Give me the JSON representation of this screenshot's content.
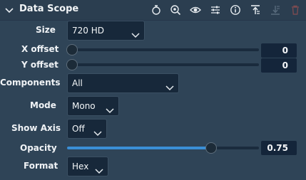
{
  "header": {
    "title": "Data Scope",
    "icons": [
      "stopwatch-icon",
      "zoom-icon",
      "eye-icon",
      "sliders-icon",
      "info-icon",
      "move-up-icon",
      "move-down-icon",
      "trash-icon"
    ]
  },
  "fields": {
    "size": {
      "label": "Size",
      "value": "720 HD"
    },
    "x_offset": {
      "label": "X offset",
      "value": "0",
      "level": 0.0
    },
    "y_offset": {
      "label": "Y offset",
      "value": "0",
      "level": 0.0
    },
    "components": {
      "label": "Components",
      "value": "All"
    },
    "mode": {
      "label": "Mode",
      "value": "Mono"
    },
    "show_axis": {
      "label": "Show Axis",
      "value": "Off"
    },
    "opacity": {
      "label": "Opacity",
      "value": "0.75",
      "level": 0.75
    },
    "format": {
      "label": "Format",
      "value": "Hex"
    }
  },
  "colors": {
    "background": "#2f4457",
    "header": "#2b3e50",
    "accent": "#3a8fd6",
    "disabled": "#7b4a50"
  }
}
